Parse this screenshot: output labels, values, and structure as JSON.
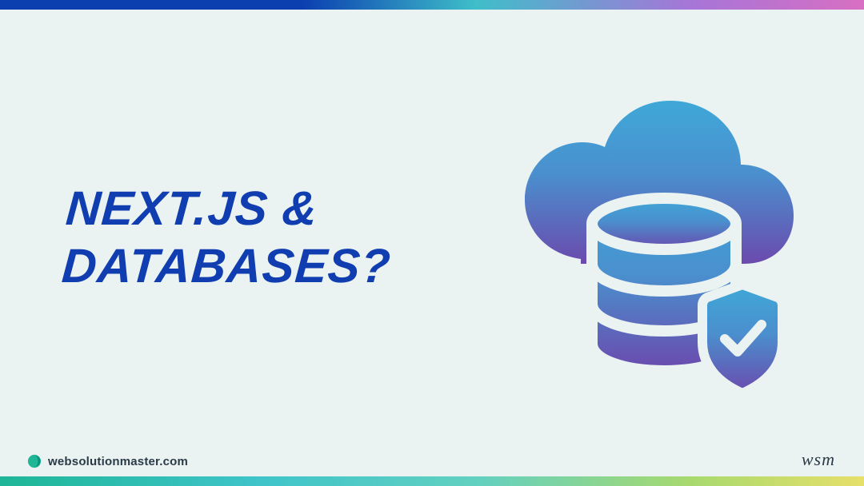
{
  "headline": {
    "line1": "NEXT.JS &",
    "line2": "DATABASES?"
  },
  "footer": {
    "site": "websolutionmaster.com",
    "monogram": "wsm"
  },
  "colors": {
    "headline": "#103eb0",
    "gradient_top_start": "#3fa8d8",
    "gradient_bottom_end": "#6b4aad"
  }
}
